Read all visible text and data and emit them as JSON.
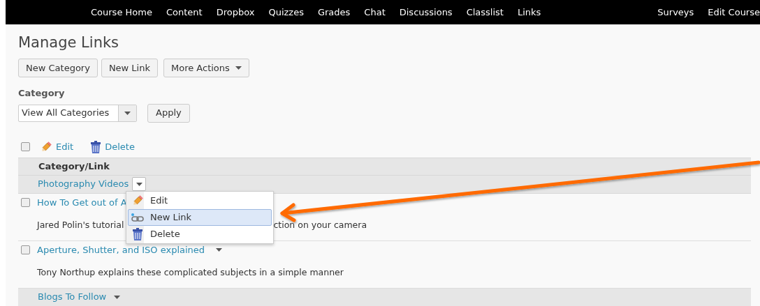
{
  "nav": {
    "items": [
      "Course Home",
      "Content",
      "Dropbox",
      "Quizzes",
      "Grades",
      "Chat",
      "Discussions",
      "Classlist",
      "Links"
    ],
    "right_items": [
      "Surveys",
      "Edit Course"
    ]
  },
  "title": "Manage Links",
  "buttons": [
    {
      "label": "New Category",
      "caret": false
    },
    {
      "label": "New Link",
      "caret": false
    },
    {
      "label": "More Actions",
      "caret": true
    }
  ],
  "filter": {
    "label": "Category",
    "value": "View All Categories",
    "apply": "Apply"
  },
  "toolbar": {
    "checked": false,
    "actions": [
      {
        "kind": "edit",
        "label": "Edit"
      },
      {
        "kind": "delete",
        "label": "Delete"
      }
    ]
  },
  "table": {
    "column": "Category/Link",
    "rows": [
      {
        "kind": "category",
        "label": "Photography Videos",
        "menu_open": true
      },
      {
        "kind": "link",
        "label": "How To Get out of A",
        "checked": false,
        "caret": false,
        "description": [
          "Jared Polin's tutorial",
          "ction on your camera"
        ]
      },
      {
        "kind": "link",
        "label": "Aperture, Shutter, and ISO explained",
        "checked": false,
        "caret": true,
        "description": [
          "Tony Northup explains these complicated subjects in a simple manner"
        ]
      },
      {
        "kind": "category",
        "label": "Blogs To Follow",
        "menu_open": false
      }
    ]
  },
  "context_menu": {
    "items": [
      {
        "kind": "edit",
        "label": "Edit",
        "selected": false
      },
      {
        "kind": "link",
        "label": "New Link",
        "selected": true
      },
      {
        "kind": "delete",
        "label": "Delete",
        "selected": false
      }
    ]
  }
}
